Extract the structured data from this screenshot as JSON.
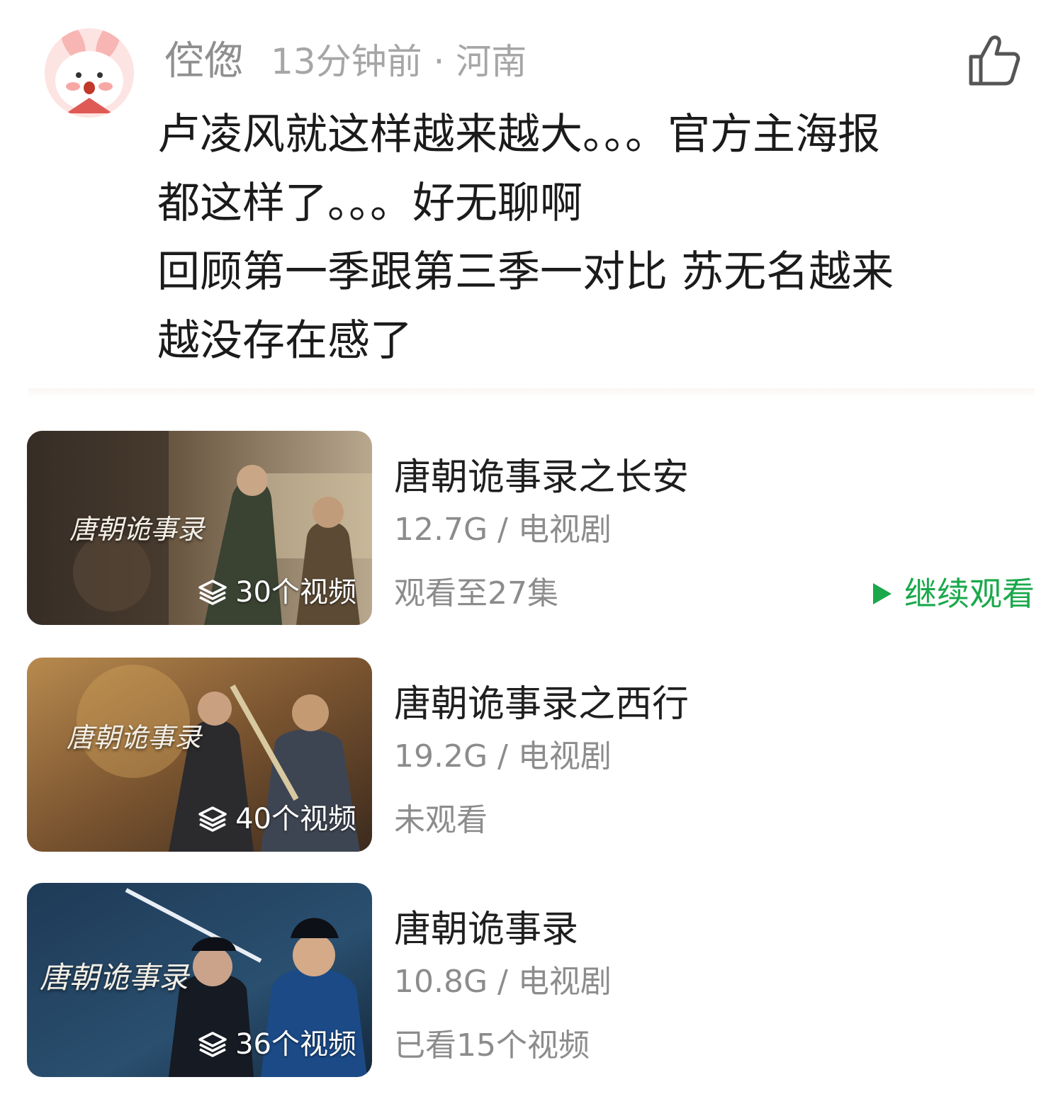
{
  "comment": {
    "author": "倥偬",
    "time_location": "13分钟前 · 河南",
    "like_icon": "thumbs-up-icon",
    "lines": [
      "卢凌风就这样越来越大。。。官方主海报",
      "都这样了。。。好无聊啊",
      "回顾第一季跟第三季一对比 苏无名越来",
      "越没存在感了"
    ]
  },
  "videos": [
    {
      "title": "唐朝诡事录之长安",
      "info": "12.7G / 电视剧",
      "status": "观看至27集",
      "count": "30个视频",
      "continue": "继续观看",
      "logo": "唐朝诡事录"
    },
    {
      "title": "唐朝诡事录之西行",
      "info": "19.2G / 电视剧",
      "status": "未观看",
      "count": "40个视频",
      "logo": "唐朝诡事录"
    },
    {
      "title": "唐朝诡事录",
      "info": "10.8G / 电视剧",
      "status": "已看15个视频",
      "count": "36个视频",
      "logo": "唐朝诡事录"
    }
  ],
  "colors": {
    "accent_green": "#1aa84b",
    "meta_gray": "#8c8c8c"
  }
}
